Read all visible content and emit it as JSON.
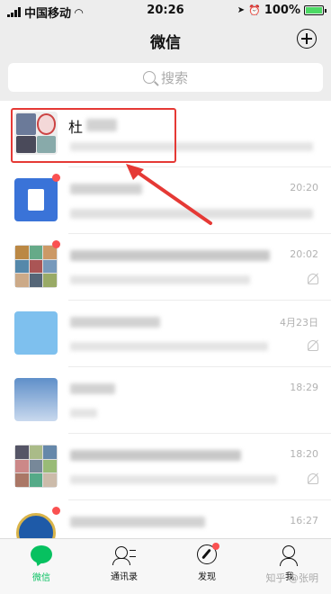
{
  "status_bar": {
    "carrier": "中国移动",
    "time": "20:26",
    "battery": "100%"
  },
  "header": {
    "title": "微信"
  },
  "search": {
    "placeholder": "搜索"
  },
  "chats": [
    {
      "name": "杜",
      "time": ""
    },
    {
      "name": "",
      "time": "20:20"
    },
    {
      "name": "",
      "time": "20:02"
    },
    {
      "name": "",
      "time": "4月23日"
    },
    {
      "name": "",
      "time": "18:29"
    },
    {
      "name": "",
      "time": "18:20"
    },
    {
      "name": "",
      "time": "16:27"
    }
  ],
  "tabbar": {
    "chats": "微信",
    "contacts": "通讯录",
    "discover": "发现",
    "me": "我"
  },
  "watermark": "知乎 @张明",
  "colors": {
    "accent": "#07c160",
    "badge": "#fa5151",
    "highlight": "#e53935"
  }
}
